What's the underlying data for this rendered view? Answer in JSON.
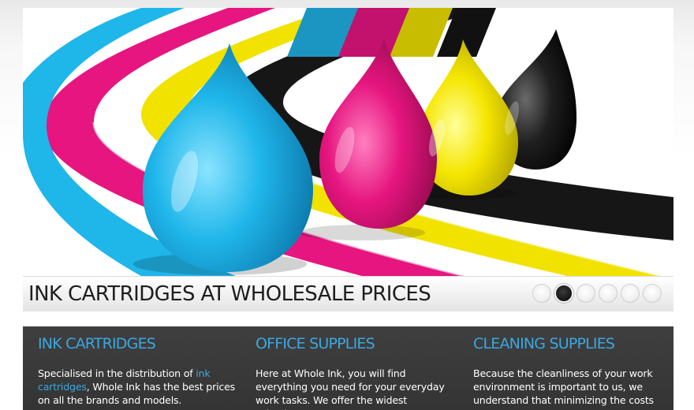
{
  "slider": {
    "caption": "INK CARTRIDGES AT WHOLESALE PRICES",
    "dot_count": 6,
    "active_dot": 2,
    "colors": {
      "cyan": "#1fb6ea",
      "magenta": "#e6157f",
      "yellow": "#f5e600",
      "black": "#1a1a1a"
    }
  },
  "columns": [
    {
      "heading": "INK CARTRIDGES",
      "text_before": "Specialised in the distribution of ",
      "link": "ink cartridges",
      "text_after": ", Whole Ink has the best prices on all the brands and models."
    },
    {
      "heading": "OFFICE SUPPLIES",
      "text": "Here at Whole Ink, you will find everything you need for your everyday work tasks. We offer the widest selection"
    },
    {
      "heading": "CLEANING SUPPLIES",
      "text": "Because the cleanliness of your work environment is important to us, we understand that minimizing the costs"
    }
  ],
  "theme": {
    "accent": "#3aa8e0",
    "panel_bg": "#3b3b3b"
  }
}
